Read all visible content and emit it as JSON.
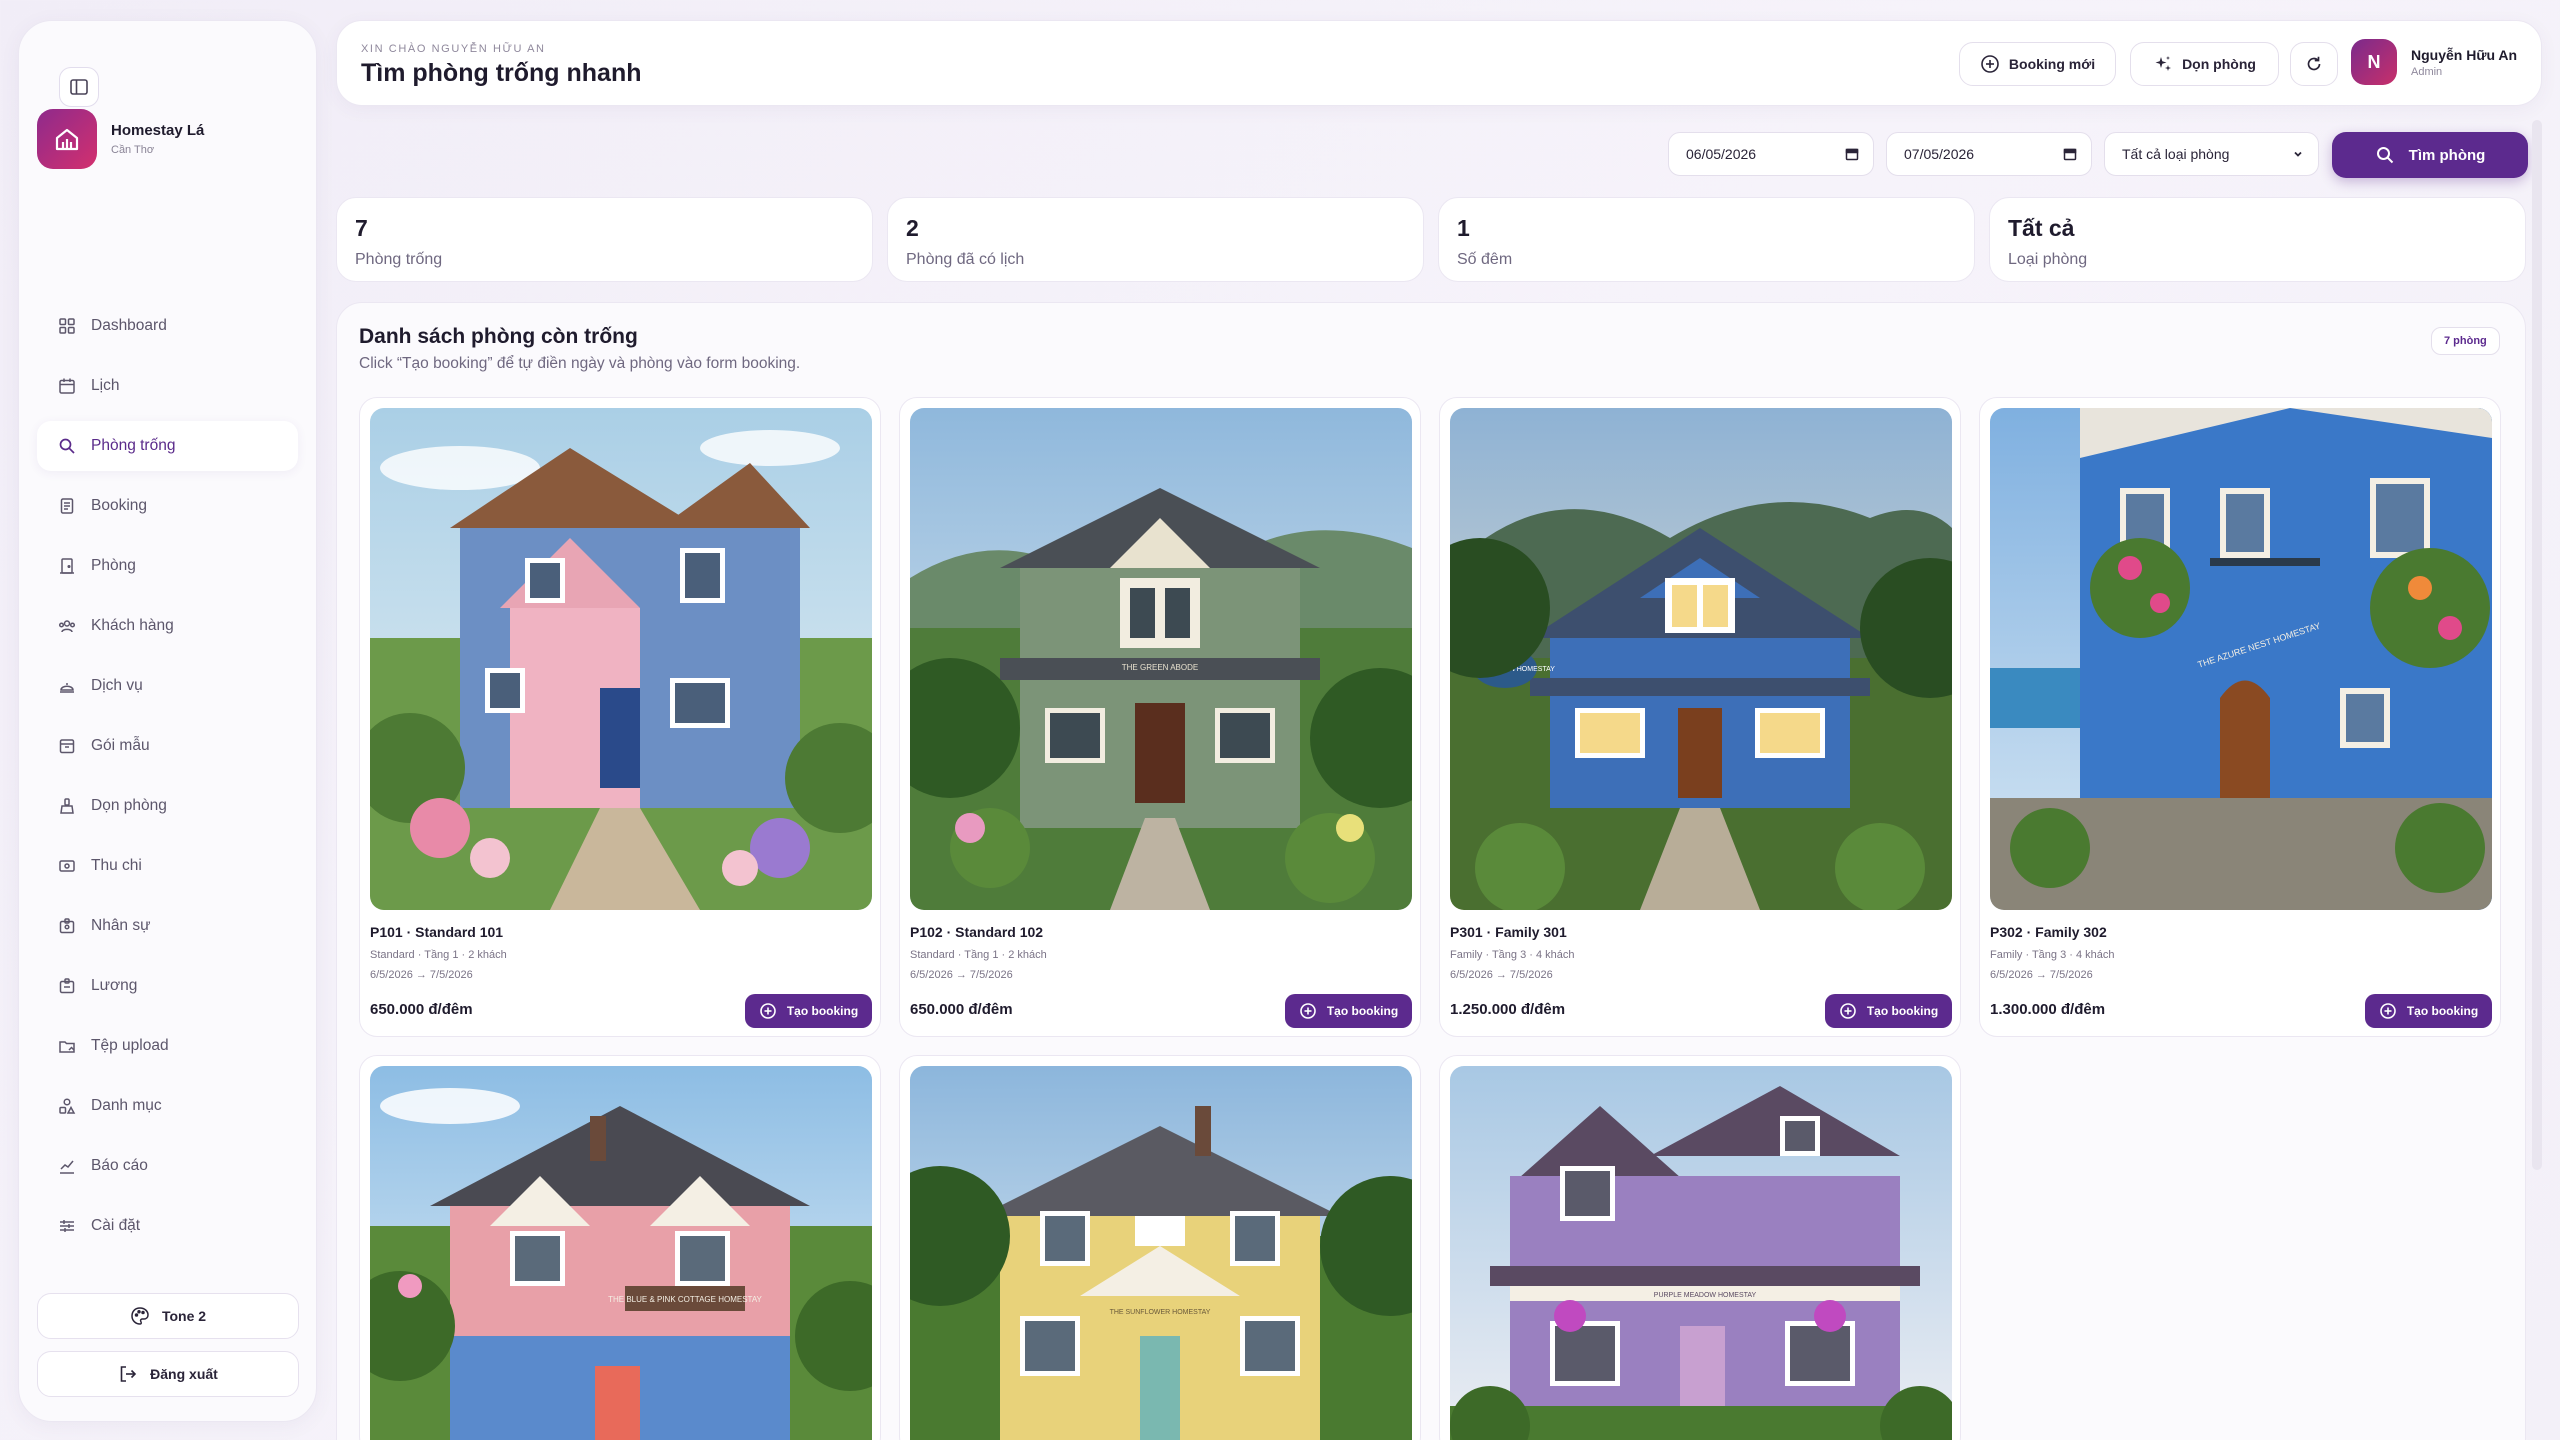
{
  "sidebar": {
    "brand_name": "Homestay Lá",
    "brand_location": "Cần Thơ",
    "items": [
      {
        "label": "Dashboard",
        "icon": "grid-icon"
      },
      {
        "label": "Lịch",
        "icon": "calendar-icon"
      },
      {
        "label": "Phòng trống",
        "icon": "search-icon"
      },
      {
        "label": "Booking",
        "icon": "receipt-icon"
      },
      {
        "label": "Phòng",
        "icon": "door-icon"
      },
      {
        "label": "Khách hàng",
        "icon": "users-icon"
      },
      {
        "label": "Dịch vụ",
        "icon": "service-bell-icon"
      },
      {
        "label": "Gói mẫu",
        "icon": "package-icon"
      },
      {
        "label": "Dọn phòng",
        "icon": "broom-icon"
      },
      {
        "label": "Thu chi",
        "icon": "wallet-icon"
      },
      {
        "label": "Nhân sự",
        "icon": "badge-icon"
      },
      {
        "label": "Lương",
        "icon": "salary-icon"
      },
      {
        "label": "Tệp upload",
        "icon": "folder-icon"
      },
      {
        "label": "Danh mục",
        "icon": "shapes-icon"
      },
      {
        "label": "Báo cáo",
        "icon": "chart-icon"
      },
      {
        "label": "Cài đặt",
        "icon": "sliders-icon"
      }
    ],
    "tone_label": "Tone 2",
    "logout_label": "Đăng xuất"
  },
  "header": {
    "greeting": "XIN CHÀO NGUYỄN HỮU AN",
    "title": "Tìm phòng trống nhanh",
    "new_booking_label": "Booking mới",
    "cleaning_label": "Dọn phòng",
    "user_initial": "N",
    "user_name": "Nguyễn Hữu An",
    "user_role": "Admin"
  },
  "filters": {
    "checkin": "06/05/2026",
    "checkout": "07/05/2026",
    "room_type": "Tất cả loại phòng",
    "search_label": "Tìm phòng"
  },
  "stats": [
    {
      "value": "7",
      "label": "Phòng trống"
    },
    {
      "value": "2",
      "label": "Phòng đã có lịch"
    },
    {
      "value": "1",
      "label": "Số đêm"
    },
    {
      "value": "Tất cả",
      "label": "Loại phòng"
    }
  ],
  "list": {
    "title": "Danh sách phòng còn trống",
    "subtitle": "Click “Tạo booking” để tự điền ngày và phòng vào form booking.",
    "count_badge": "7 phòng",
    "book_label": "Tạo booking"
  },
  "rooms": [
    {
      "title": "P101 · Standard 101",
      "meta": "Standard · Tầng 1 · 2 khách",
      "dates": "6/5/2026 → 7/5/2026",
      "price": "650.000 đ/đêm"
    },
    {
      "title": "P102 · Standard 102",
      "meta": "Standard · Tầng 1 · 2 khách",
      "dates": "6/5/2026 → 7/5/2026",
      "price": "650.000 đ/đêm"
    },
    {
      "title": "P301 · Family 301",
      "meta": "Family · Tầng 3 · 4 khách",
      "dates": "6/5/2026 → 7/5/2026",
      "price": "1.250.000 đ/đêm"
    },
    {
      "title": "P302 · Family 302",
      "meta": "Family · Tầng 3 · 4 khách",
      "dates": "6/5/2026 → 7/5/2026",
      "price": "1.300.000 đ/đêm"
    },
    {
      "title": "",
      "meta": "",
      "dates": "",
      "price": ""
    },
    {
      "title": "",
      "meta": "",
      "dates": "",
      "price": ""
    },
    {
      "title": "",
      "meta": "",
      "dates": "",
      "price": ""
    }
  ],
  "sign_texts": {
    "green": "THE GREEN ABODE",
    "blue": "THE BLUE HAVEN HOMESTAY",
    "azure": "THE AZURE NEST HOMESTAY",
    "cottage": "THE BLUE & PINK COTTAGE HOMESTAY",
    "sunflower": "THE SUNFLOWER HOMESTAY",
    "purple": "PURPLE MEADOW HOMESTAY"
  },
  "colors": {
    "accent": "#5c2a8e",
    "brand_gradient_start": "#8e2a8c",
    "brand_gradient_end": "#d3306e"
  }
}
